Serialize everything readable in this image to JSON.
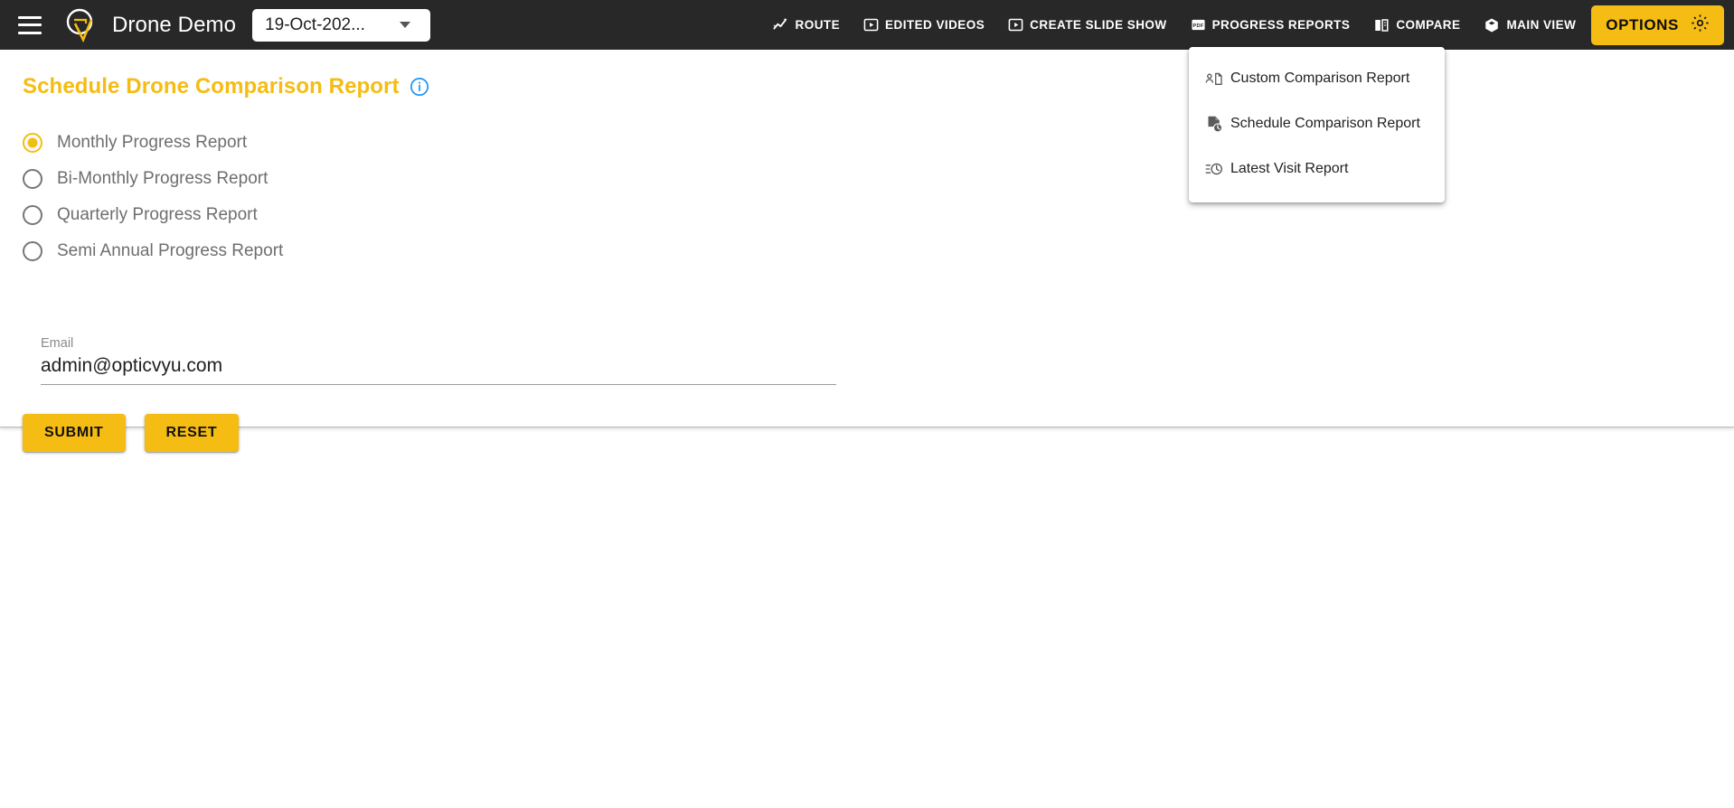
{
  "header": {
    "menu_icon": "hamburger-icon",
    "logo_icon": "opticvyu-logo",
    "app_title": "Drone Demo",
    "date_select": {
      "value": "19-Oct-202...",
      "caret_icon": "chevron-down-icon"
    },
    "nav": [
      {
        "label": "ROUTE",
        "icon": "route-sparkle-icon"
      },
      {
        "label": "EDITED VIDEOS",
        "icon": "play-box-icon"
      },
      {
        "label": "CREATE SLIDE SHOW",
        "icon": "play-box-icon"
      },
      {
        "label": "PROGRESS REPORTS",
        "icon": "pdf-icon"
      },
      {
        "label": "COMPARE",
        "icon": "compare-split-icon"
      },
      {
        "label": "MAIN VIEW",
        "icon": "cube-icon"
      }
    ],
    "options": {
      "label": "OPTIONS",
      "icon": "gear-icon"
    }
  },
  "dropdown": {
    "open": true,
    "items": [
      {
        "label": "Custom Comparison Report",
        "icon": "person-document-icon"
      },
      {
        "label": "Schedule Comparison Report",
        "icon": "document-clock-icon"
      },
      {
        "label": "Latest Visit Report",
        "icon": "list-clock-icon"
      }
    ]
  },
  "main": {
    "title": "Schedule Drone Comparison Report",
    "info_icon": "info-circle-icon",
    "radio_group": {
      "selected_index": 0,
      "options": [
        {
          "label": "Monthly Progress Report"
        },
        {
          "label": "Bi-Monthly Progress Report"
        },
        {
          "label": "Quarterly Progress Report"
        },
        {
          "label": "Semi Annual Progress Report"
        }
      ]
    },
    "email_field": {
      "label": "Email",
      "value": "admin@opticvyu.com",
      "placeholder": "Email"
    },
    "buttons": {
      "submit": "SUBMIT",
      "reset": "RESET"
    }
  },
  "colors": {
    "accent": "#F5BC13",
    "header_bg": "#282828",
    "text_muted": "#6e6e6e",
    "info_blue": "#2196F3"
  }
}
